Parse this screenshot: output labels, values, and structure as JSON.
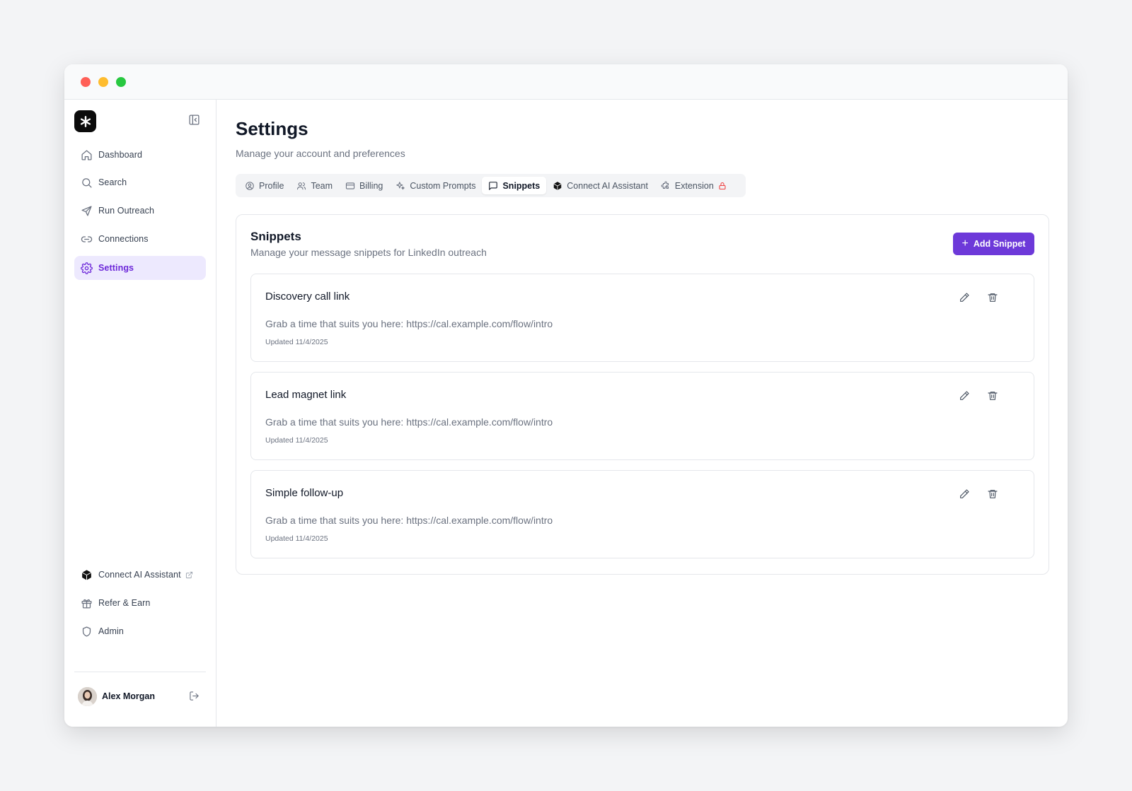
{
  "sidebar": {
    "nav": [
      {
        "label": "Dashboard",
        "icon": "home-icon"
      },
      {
        "label": "Search",
        "icon": "search-icon"
      },
      {
        "label": "Run Outreach",
        "icon": "send-icon"
      },
      {
        "label": "Connections",
        "icon": "link-icon"
      },
      {
        "label": "Settings",
        "icon": "gear-icon",
        "active": true
      }
    ],
    "bottom_nav": [
      {
        "label": "Connect AI Assistant",
        "icon": "cube-icon",
        "external": true
      },
      {
        "label": "Refer & Earn",
        "icon": "gift-icon"
      },
      {
        "label": "Admin",
        "icon": "shield-icon"
      }
    ],
    "user": {
      "name": "Alex Morgan"
    }
  },
  "page": {
    "title": "Settings",
    "subtitle": "Manage your account and preferences"
  },
  "tabs": [
    {
      "label": "Profile",
      "icon": "user-circle-icon"
    },
    {
      "label": "Team",
      "icon": "users-icon"
    },
    {
      "label": "Billing",
      "icon": "credit-card-icon"
    },
    {
      "label": "Custom Prompts",
      "icon": "sparkles-icon"
    },
    {
      "label": "Snippets",
      "icon": "message-square-icon",
      "active": true
    },
    {
      "label": "Connect AI Assistant",
      "icon": "cube-icon"
    },
    {
      "label": "Extension",
      "icon": "puzzle-icon",
      "locked": true
    }
  ],
  "snippets_card": {
    "title": "Snippets",
    "subtitle": "Manage your message snippets for LinkedIn outreach",
    "add_button": "Add Snippet",
    "items": [
      {
        "title": "Discovery call link",
        "body": "Grab a time that suits you here: https://cal.example.com/flow/intro",
        "updated": "Updated 11/4/2025"
      },
      {
        "title": "Lead magnet link",
        "body": "Grab a time that suits you here: https://cal.example.com/flow/intro",
        "updated": "Updated 11/4/2025"
      },
      {
        "title": "Simple follow-up",
        "body": "Grab a time that suits you here: https://cal.example.com/flow/intro",
        "updated": "Updated 11/4/2025"
      }
    ]
  },
  "colors": {
    "accent": "#6d39d9",
    "active_nav_bg": "#ede9fe",
    "lock": "#ef4444"
  }
}
